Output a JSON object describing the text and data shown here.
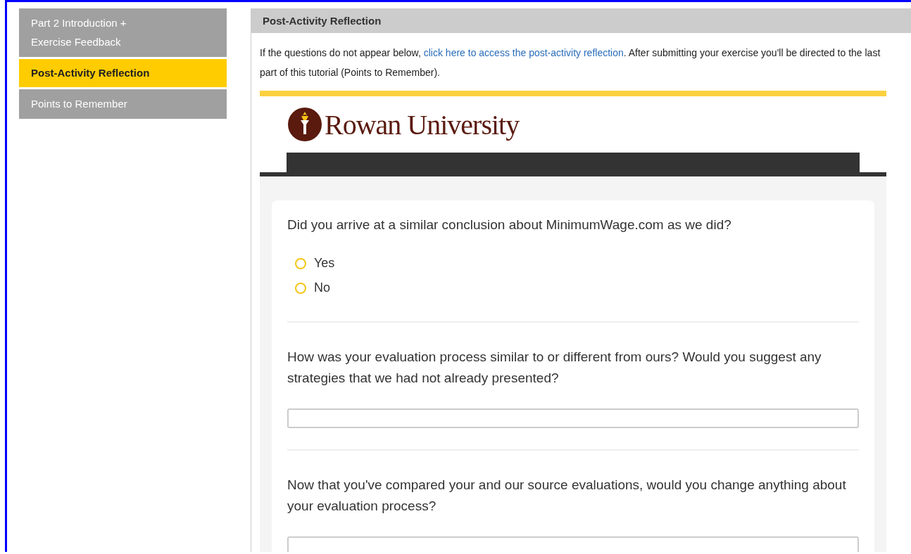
{
  "sidebar": {
    "items": [
      {
        "label": "Part 2 Introduction + Exercise Feedback",
        "selected": false
      },
      {
        "label": "Post-Activity Reflection",
        "selected": true
      },
      {
        "label": "Points to Remember",
        "selected": false
      }
    ]
  },
  "panel": {
    "title": "Post-Activity Reflection",
    "intro": {
      "before": "If the questions do not appear below, ",
      "link": "click here to access the post-activity reflection",
      "after": ". After submitting your exercise you'll be directed to the last part of this tutorial (Points to Remember)."
    },
    "form": {
      "logo_text": "Rowan University",
      "questions": [
        {
          "kind": "choice",
          "text": "Did you arrive at a similar conclusion about MinimumWage.com as we did?",
          "options": [
            {
              "label": "Yes",
              "selected": false
            },
            {
              "label": "No",
              "selected": false
            }
          ]
        },
        {
          "kind": "text",
          "text": "How was your evaluation process similar to or different from ours? Would you suggest any strategies that we had not already presented?"
        },
        {
          "kind": "text",
          "text": "Now that you've compared your and our source evaluations, would you change anything about your evaluation process?"
        }
      ]
    }
  }
}
